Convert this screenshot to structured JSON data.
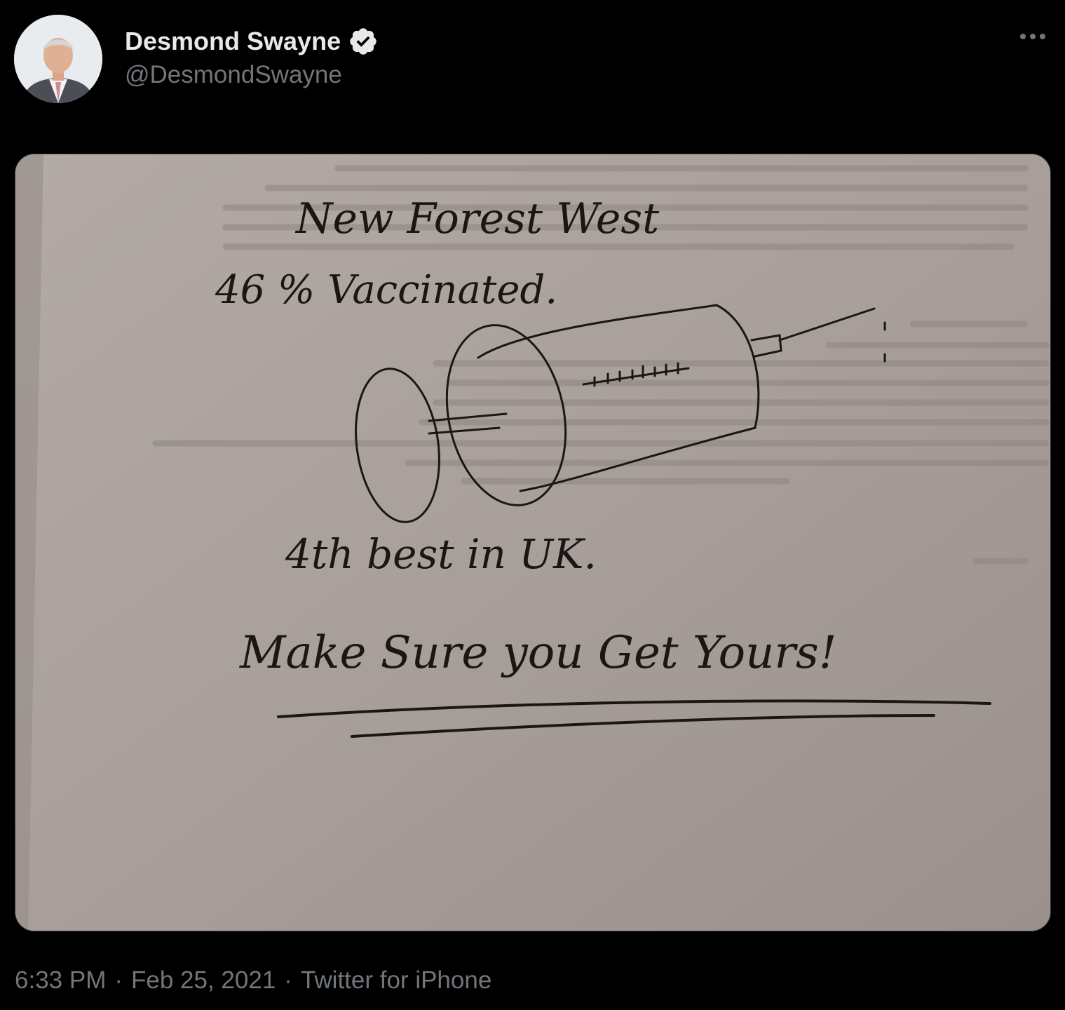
{
  "tweet": {
    "author": {
      "display_name": "Desmond Swayne",
      "handle": "@DesmondSwayne",
      "verified": true,
      "avatar_icon": "profile-photo-man-in-suit"
    },
    "more_icon": "more-options-icon",
    "media": {
      "type": "photo",
      "description_icon": "handwritten-note-syringe-drawing",
      "handwriting": {
        "line1": "New Forest West",
        "line2": "46 % Vaccinated.",
        "line3": "4th best in UK.",
        "line4": "Make Sure you Get Yours!"
      }
    },
    "time": "6:33 PM",
    "date": "Feb 25, 2021",
    "source": "Twitter for iPhone",
    "separator": "·"
  },
  "colors": {
    "background": "#000000",
    "primary_text": "#e7e9ea",
    "secondary_text": "#71767b",
    "verified_badge": "#e7e9ea",
    "paper": "#a89f9b",
    "ink": "#1b1614"
  }
}
